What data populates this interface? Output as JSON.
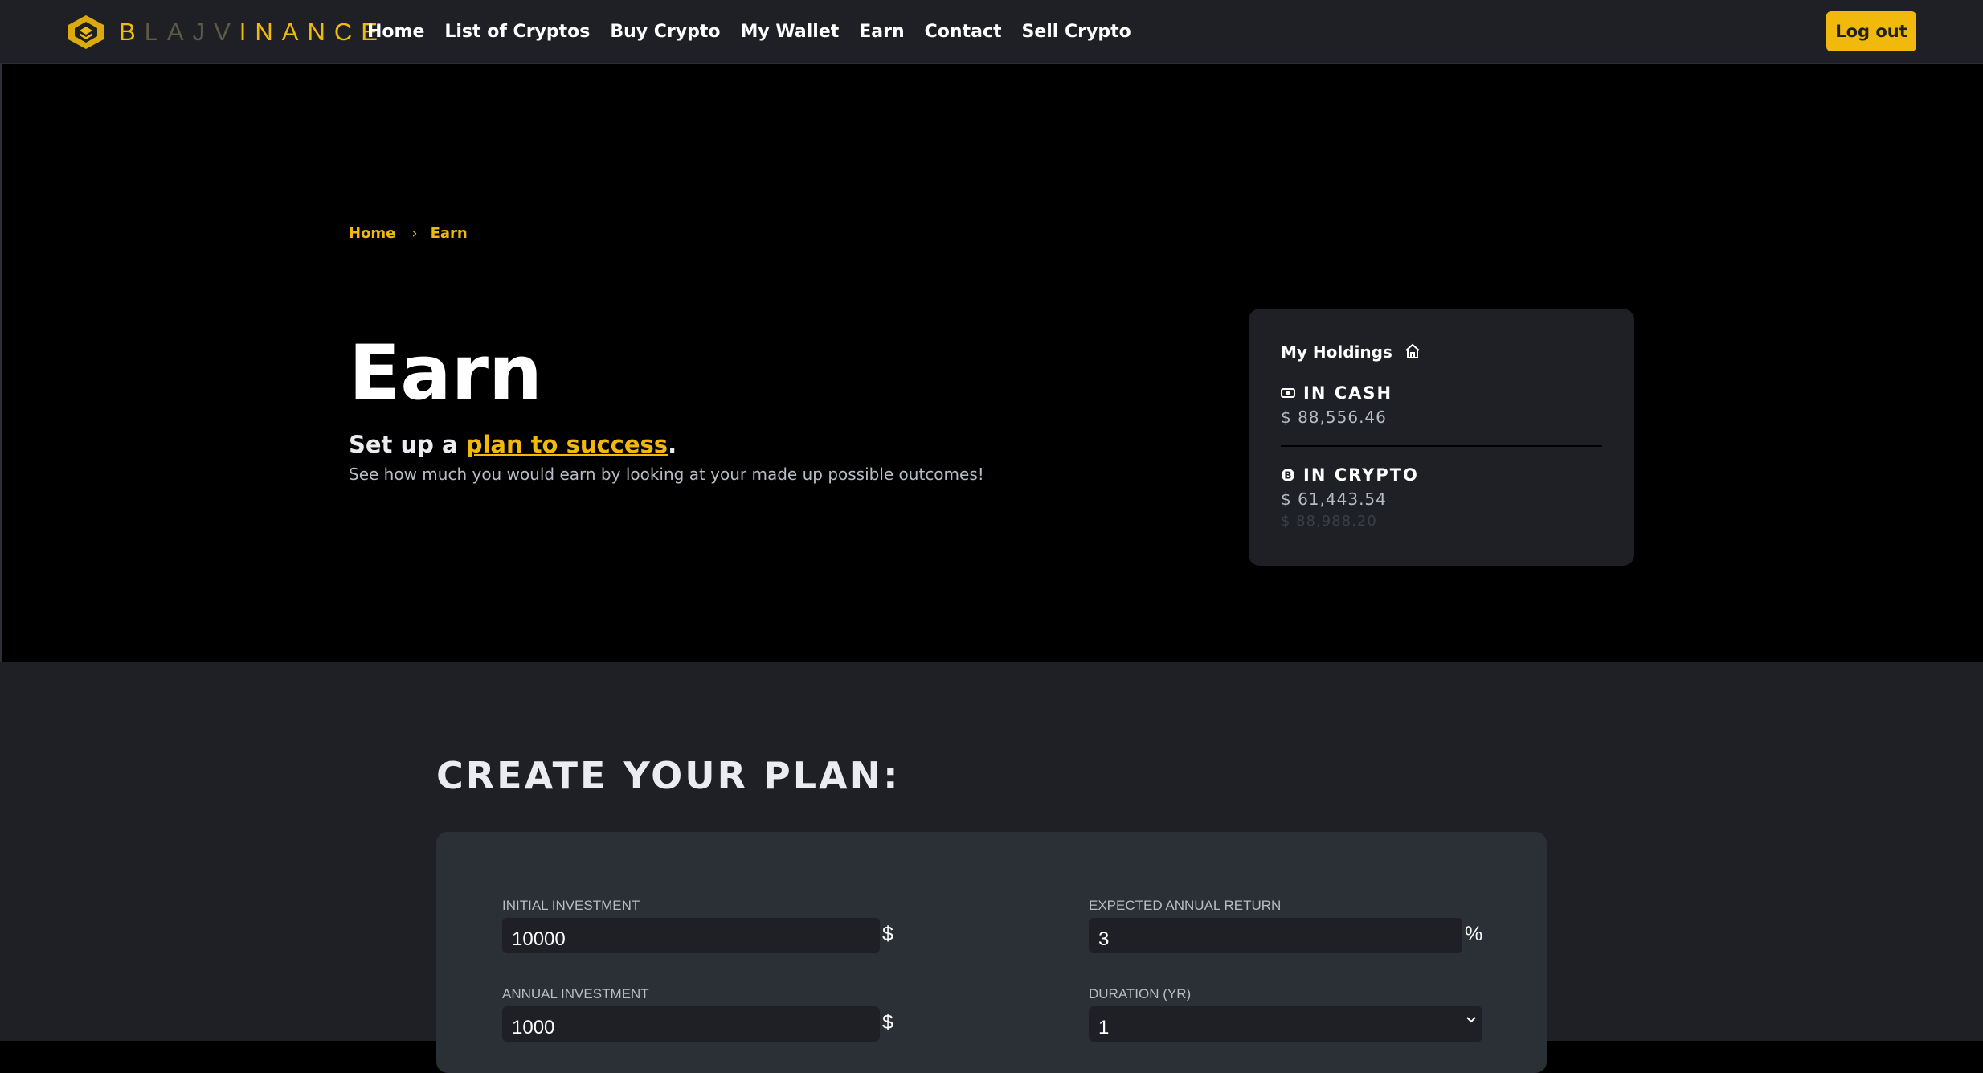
{
  "nav": {
    "brand_parts": [
      "B",
      "LAJV",
      "INANCE"
    ],
    "links": [
      "Home",
      "List of Cryptos",
      "Buy Crypto",
      "My Wallet",
      "Earn",
      "Contact",
      "Sell Crypto"
    ],
    "logout_label": "Log out"
  },
  "breadcrumb": {
    "home": "Home",
    "separator": "›",
    "current": "Earn"
  },
  "hero": {
    "title": "Earn",
    "subtitle_prefix": "Set up a ",
    "subtitle_link": "plan to success",
    "subtitle_suffix": ".",
    "description": "See how much you would earn by looking at your made up possible outcomes!"
  },
  "holdings": {
    "title": "My Holdings",
    "cash_label": "IN CASH",
    "cash_value": "$ 88,556.46",
    "crypto_label": "IN CRYPTO",
    "crypto_value": "$ 61,443.54",
    "crypto_secondary": "$ 88,988.20"
  },
  "plan": {
    "title": "CREATE YOUR PLAN:",
    "initial_investment_label": "INITIAL INVESTMENT",
    "initial_investment_value": "10000",
    "initial_investment_unit": "$",
    "annual_return_label": "EXPECTED ANNUAL RETURN",
    "annual_return_value": "3",
    "annual_return_unit": "%",
    "annual_investment_label": "ANNUAL INVESTMENT",
    "annual_investment_value": "1000",
    "annual_investment_unit": "$",
    "duration_label": "DURATION (YR)",
    "duration_value": "1"
  },
  "colors": {
    "accent": "#f0b90b",
    "nav_bg": "#1e2026",
    "card_bg": "#2b2f36"
  }
}
